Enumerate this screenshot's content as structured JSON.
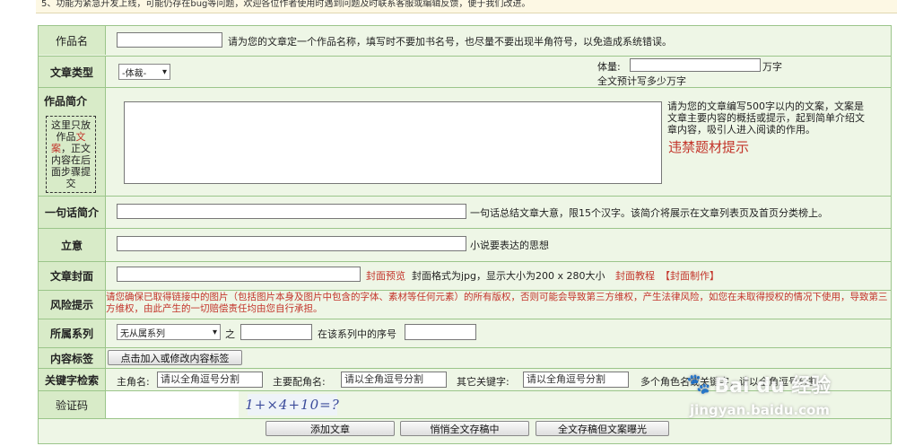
{
  "top_note": "5、功能为紧急开发上线，可能仍存在bug等问题，欢迎各位作者使用时遇到问题及时联系客服或编辑反馈，便于我们改进。",
  "work_name": {
    "label": "作品名",
    "value": "",
    "hint": "请为您的文章定一个作品名称，填写时不要加书名号，也尽量不要出现半角符号，以免造成系统错误。"
  },
  "article_type": {
    "label": "文章类型",
    "select_value": "-体裁-",
    "volume_label": "体量:",
    "volume_value": "",
    "volume_unit": "万字",
    "volume_hint": "全文预计写多少万字"
  },
  "synopsis": {
    "label": "作品简介",
    "note_before": "这里只放作品",
    "note_red": "文案",
    "note_after": "，正文内容在后面步骤提交",
    "value": "",
    "hint": "请为您的文章编写500字以内的文案，文案是文章主要内容的概括或提示，起到简单介绍文章内容，吸引人进入阅读的作用。",
    "forbidden_link": "违禁题材提示"
  },
  "one_sentence": {
    "label": "一句话简介",
    "value": "",
    "hint": "一句话总结文章大意，限15个汉字。该简介将展示在文章列表页及首页分类榜上。"
  },
  "theme": {
    "label": "立意",
    "value": "",
    "hint": "小说要表达的思想"
  },
  "cover": {
    "label": "文章封面",
    "value": "",
    "preview_link": "封面预览",
    "hint": "封面格式为jpg，显示大小为200 x 280大小",
    "tutorial_link": "封面教程",
    "make_link": "【封面制作】"
  },
  "risk": {
    "label": "风险提示",
    "text": "请您确保已取得链接中的图片（包括图片本身及图片中包含的字体、素材等任何元素）的所有版权，否则可能会导致第三方维权，产生法律风险，如您在未取得授权的情况下使用，导致第三方维权，由此产生的一切赔偿责任均由您自行承担。"
  },
  "series": {
    "label": "所属系列",
    "select_value": "无从属系列",
    "of_text": "之",
    "value": "",
    "order_text": "在该系列中的序号",
    "order_value": ""
  },
  "tags": {
    "label": "内容标签",
    "button": "点击加入或修改内容标签"
  },
  "keywords": {
    "label": "关键字检索",
    "lead_label": "主角名:",
    "lead_value": "请以全角逗号分割",
    "support_label": "主要配角名:",
    "support_value": "请以全角逗号分割",
    "other_label": "其它关键字:",
    "other_value": "请以全角逗号分割",
    "trailing_text": "多个角色名或关键字，请以全角逗号分割。"
  },
  "captcha": {
    "label": "验证码",
    "value": "",
    "image_text": "1+×4+10=?"
  },
  "actions": {
    "add": "添加文章",
    "quiet": "悄悄全文存稿中",
    "expose": "全文存稿但文案曝光"
  },
  "watermark": {
    "brand": "Bai du 经验",
    "url": "jingyan.baidu.com"
  },
  "colors": {
    "red_link": "#c3342a",
    "row_bg": "#eef6e6",
    "label_bg": "#d8ebc8",
    "border": "#9bc58a"
  }
}
